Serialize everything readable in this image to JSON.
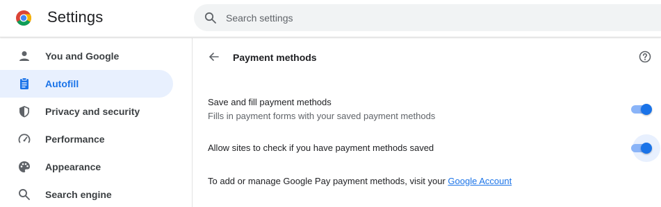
{
  "header": {
    "title": "Settings",
    "logo_icon": "chrome-logo-icon",
    "search": {
      "placeholder": "Search settings",
      "value": ""
    }
  },
  "sidebar": {
    "items": [
      {
        "label": "You and Google",
        "icon": "person-icon",
        "selected": false
      },
      {
        "label": "Autofill",
        "icon": "clipboard-icon",
        "selected": true
      },
      {
        "label": "Privacy and security",
        "icon": "shield-icon",
        "selected": false
      },
      {
        "label": "Performance",
        "icon": "speedometer-icon",
        "selected": false
      },
      {
        "label": "Appearance",
        "icon": "palette-icon",
        "selected": false
      },
      {
        "label": "Search engine",
        "icon": "search-icon",
        "selected": false
      }
    ]
  },
  "main": {
    "title": "Payment methods",
    "settings": [
      {
        "title": "Save and fill payment methods",
        "subtitle": "Fills in payment forms with your saved payment methods",
        "enabled": true
      },
      {
        "title": "Allow sites to check if you have payment methods saved",
        "enabled": true
      }
    ],
    "footer": {
      "text": "To add or manage Google Pay payment methods, visit your ",
      "link": "Google Account"
    }
  },
  "colors": {
    "accent": "#1a73e8",
    "selected_bg": "#e8f0fe",
    "toggle_track": "#8ab4f8"
  }
}
